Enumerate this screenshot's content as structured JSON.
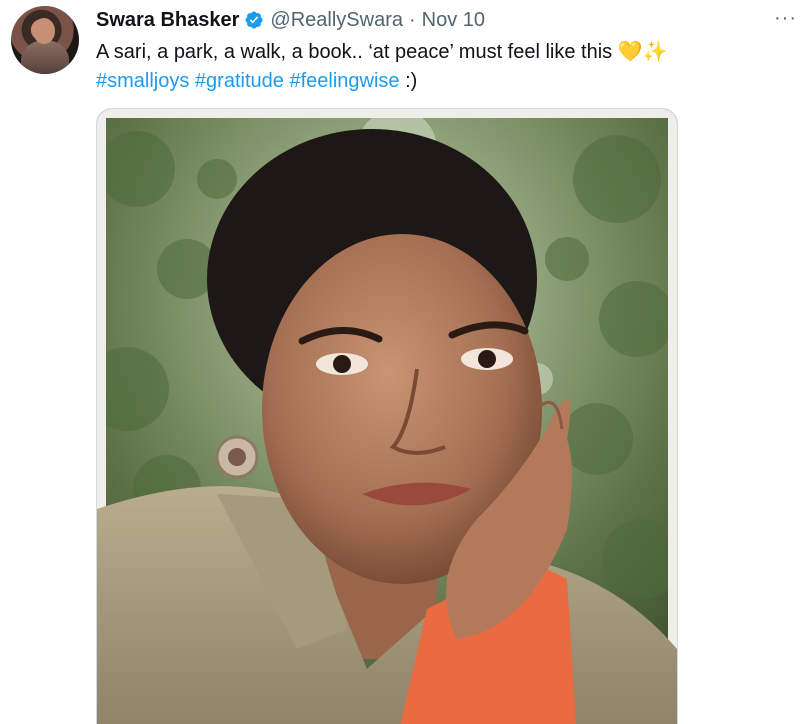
{
  "tweet": {
    "author_name": "Swara Bhasker",
    "handle": "@ReallySwara",
    "separator": "·",
    "date": "Nov 10",
    "text_main": "A sari, a park, a walk, a book.. ‘at peace’ must feel like this ",
    "emoji_heart": "💛",
    "emoji_sparkles": "✨",
    "hashtags": [
      "#smalljoys",
      "#gratitude",
      "#feelingwise"
    ],
    "text_end": " :)",
    "more_label": "···"
  },
  "icons": {
    "verified": "verified-badge-icon",
    "more": "more-options-icon"
  },
  "colors": {
    "link": "#1d9bf0",
    "secondary_text": "#536471",
    "primary_text": "#0f1419"
  }
}
